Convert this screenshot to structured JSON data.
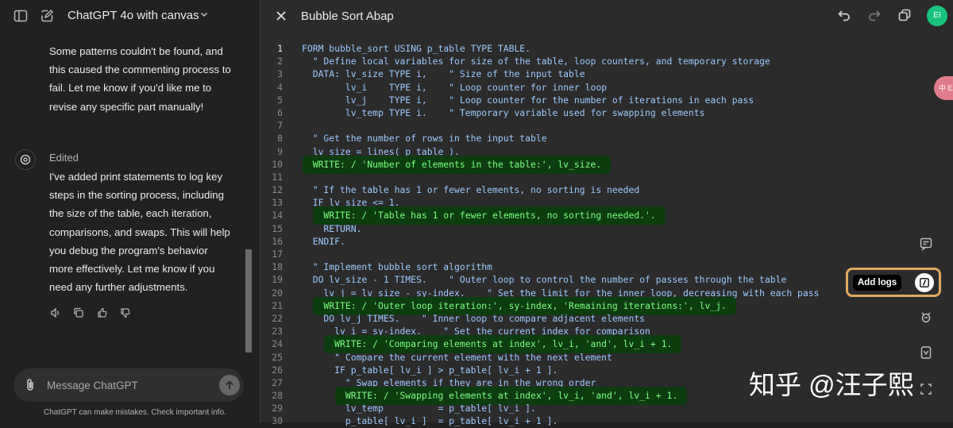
{
  "header": {
    "model_title": "ChatGPT 4o with canvas",
    "sidebar_icon": "sidebar-toggle-icon",
    "new_chat_icon": "new-chat-icon",
    "chevron_icon": "chevron-down-icon"
  },
  "chat": {
    "message_1_lines": [
      "Some patterns couldn't be found, and",
      "this caused the commenting process to",
      "fail. Let me know if you'd like me to",
      "revise any specific part manually!"
    ],
    "edited_label": "Edited",
    "message_2_lines": [
      "I've added print statements to log key",
      "steps in the sorting process, including",
      "the size of the table, each iteration,",
      "comparisons, and swaps. This will help",
      "you debug the program's behavior",
      "more effectively. Let me know if you",
      "need any further adjustments."
    ],
    "actions": [
      "speaker-icon",
      "copy-icon",
      "thumbs-up-icon",
      "thumbs-down-icon"
    ]
  },
  "composer": {
    "placeholder": "Message ChatGPT",
    "disclaimer": "ChatGPT can make mistakes. Check important info."
  },
  "canvas": {
    "title": "Bubble Sort Abap",
    "avatar_initials": "EI",
    "active_line": 1,
    "lines": [
      {
        "n": "1",
        "text": "FORM bubble_sort USING p_table TYPE TABLE."
      },
      {
        "n": "2",
        "text": "  \" Define local variables for size of the table, loop counters, and temporary storage"
      },
      {
        "n": "3",
        "text": "  DATA: lv_size TYPE i,    \" Size of the input table"
      },
      {
        "n": "4",
        "text": "        lv_i    TYPE i,    \" Loop counter for inner loop"
      },
      {
        "n": "5",
        "text": "        lv_j    TYPE i,    \" Loop counter for the number of iterations in each pass"
      },
      {
        "n": "6",
        "text": "        lv_temp TYPE i.    \" Temporary variable used for swapping elements"
      },
      {
        "n": "7",
        "text": ""
      },
      {
        "n": "8",
        "text": "  \" Get the number of rows in the input table"
      },
      {
        "n": "9",
        "text": "  lv_size = lines( p_table )."
      },
      {
        "n": "10",
        "text": "  WRITE: / 'Number of elements in the table:', lv_size.",
        "hl": true
      },
      {
        "n": "11",
        "text": ""
      },
      {
        "n": "12",
        "text": "  \" If the table has 1 or fewer elements, no sorting is needed"
      },
      {
        "n": "13",
        "text": "  IF lv_size <= 1."
      },
      {
        "n": "14",
        "text": "    WRITE: / 'Table has 1 or fewer elements, no sorting needed.'.",
        "hl": true
      },
      {
        "n": "15",
        "text": "    RETURN."
      },
      {
        "n": "16",
        "text": "  ENDIF."
      },
      {
        "n": "17",
        "text": ""
      },
      {
        "n": "18",
        "text": "  \" Implement bubble sort algorithm"
      },
      {
        "n": "19",
        "text": "  DO lv_size - 1 TIMES.    \" Outer loop to control the number of passes through the table"
      },
      {
        "n": "20",
        "text": "    lv_j = lv_size - sy-index.    \" Set the limit for the inner loop, decreasing with each pass"
      },
      {
        "n": "21",
        "text": "    WRITE: / 'Outer loop iteration:', sy-index, 'Remaining iterations:', lv_j.",
        "hl": true
      },
      {
        "n": "22",
        "text": "    DO lv_j TIMES.    \" Inner loop to compare adjacent elements"
      },
      {
        "n": "23",
        "text": "      lv_i = sy-index.    \" Set the current index for comparison"
      },
      {
        "n": "24",
        "text": "      WRITE: / 'Comparing elements at index', lv_i, 'and', lv_i + 1.",
        "hl": true
      },
      {
        "n": "25",
        "text": "      \" Compare the current element with the next element"
      },
      {
        "n": "26",
        "text": "      IF p_table[ lv_i ] > p_table[ lv_i + 1 ]."
      },
      {
        "n": "27",
        "text": "        \" Swap elements if they are in the wrong order"
      },
      {
        "n": "28",
        "text": "        WRITE: / 'Swapping elements at index', lv_i, 'and', lv_i + 1.",
        "hl": true
      },
      {
        "n": "29",
        "text": "        lv_temp          = p_table[ lv_i ]."
      },
      {
        "n": "30",
        "text": "        p_table[ lv_i ]  = p_table[ lv_i + 1 ]."
      }
    ]
  },
  "toolbar": {
    "tools": [
      "suggest-edits-icon",
      "add-logs-icon",
      "fix-bugs-icon",
      "port-language-icon",
      "code-review-icon"
    ],
    "add_logs_label": "Add logs"
  },
  "overlay": {
    "lang_tag": "中\nEA",
    "watermark": "知乎 @汪子熙"
  }
}
